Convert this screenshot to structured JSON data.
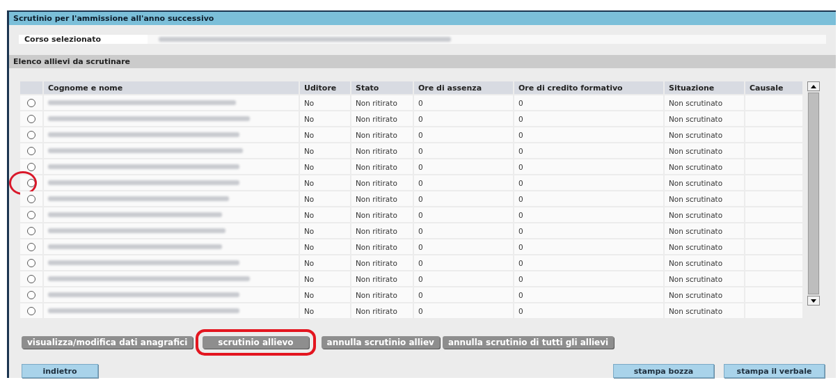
{
  "window": {
    "title": "Scrutinio per l'ammissione all'anno successivo"
  },
  "course": {
    "label": "Corso selezionato"
  },
  "section": {
    "title": "Elenco allievi da scrutinare"
  },
  "table": {
    "columns": [
      "Cognome e nome",
      "Uditore",
      "Stato",
      "Ore di assenza",
      "Ore di credito formativo",
      "Situazione",
      "Causale"
    ],
    "rows": [
      {
        "selected": false,
        "highlighted": false,
        "cells": [
          "",
          "No",
          "Non ritirato",
          "0",
          "0",
          "Non scrutinato",
          ""
        ]
      },
      {
        "selected": false,
        "highlighted": false,
        "cells": [
          "",
          "No",
          "Non ritirato",
          "0",
          "0",
          "Non scrutinato",
          ""
        ]
      },
      {
        "selected": false,
        "highlighted": false,
        "cells": [
          "",
          "No",
          "Non ritirato",
          "0",
          "0",
          "Non scrutinato",
          ""
        ]
      },
      {
        "selected": false,
        "highlighted": false,
        "cells": [
          "",
          "No",
          "Non ritirato",
          "0",
          "0",
          "Non scrutinato",
          ""
        ]
      },
      {
        "selected": false,
        "highlighted": false,
        "cells": [
          "",
          "No",
          "Non ritirato",
          "0",
          "0",
          "Non scrutinato",
          ""
        ]
      },
      {
        "selected": false,
        "highlighted": true,
        "cells": [
          "",
          "No",
          "Non ritirato",
          "0",
          "0",
          "Non scrutinato",
          ""
        ]
      },
      {
        "selected": false,
        "highlighted": false,
        "cells": [
          "",
          "No",
          "Non ritirato",
          "0",
          "0",
          "Non scrutinato",
          ""
        ]
      },
      {
        "selected": false,
        "highlighted": false,
        "cells": [
          "",
          "No",
          "Non ritirato",
          "0",
          "0",
          "Non scrutinato",
          ""
        ]
      },
      {
        "selected": false,
        "highlighted": false,
        "cells": [
          "",
          "No",
          "Non ritirato",
          "0",
          "0",
          "Non scrutinato",
          ""
        ]
      },
      {
        "selected": false,
        "highlighted": false,
        "cells": [
          "",
          "No",
          "Non ritirato",
          "0",
          "0",
          "Non scrutinato",
          ""
        ]
      },
      {
        "selected": false,
        "highlighted": false,
        "cells": [
          "",
          "No",
          "Non ritirato",
          "0",
          "0",
          "Non scrutinato",
          ""
        ]
      },
      {
        "selected": false,
        "highlighted": false,
        "cells": [
          "",
          "No",
          "Non ritirato",
          "0",
          "0",
          "Non scrutinato",
          ""
        ]
      },
      {
        "selected": false,
        "highlighted": false,
        "cells": [
          "",
          "No",
          "Non ritirato",
          "0",
          "0",
          "Non scrutinato",
          ""
        ]
      },
      {
        "selected": false,
        "highlighted": false,
        "cells": [
          "",
          "No",
          "Non ritirato",
          "0",
          "0",
          "Non scrutinato",
          ""
        ]
      }
    ]
  },
  "action_buttons": [
    {
      "label": "visualizza/modifica dati anagrafici",
      "highlighted": false
    },
    {
      "label": "scrutinio allievo",
      "highlighted": true
    },
    {
      "label": "annulla scrutinio alliev",
      "highlighted": false
    },
    {
      "label": "annulla scrutinio di tutti gli allievi",
      "highlighted": false
    }
  ],
  "footer_buttons": [
    {
      "label": "indietro",
      "kind": "left"
    },
    {
      "label": "stampa bozza",
      "kind": "right"
    },
    {
      "label": "stampa il verbale",
      "kind": "right"
    }
  ]
}
